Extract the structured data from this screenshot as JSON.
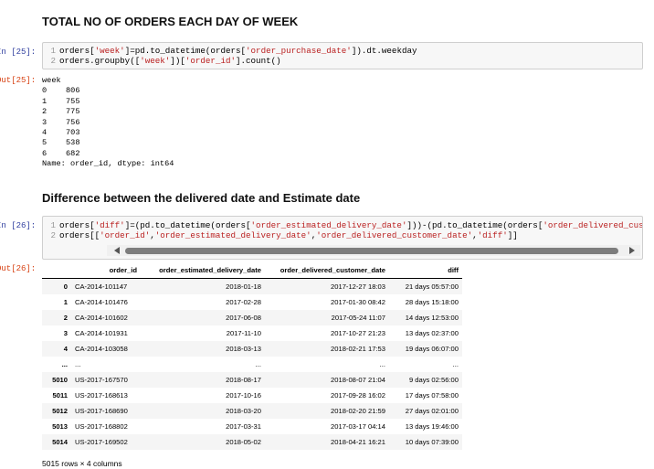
{
  "section1": {
    "heading": "TOTAL NO OF ORDERS EACH DAY OF WEEK",
    "in_prompt": "In [25]:",
    "out_prompt": "Out[25]:",
    "code": [
      {
        "num": "1",
        "parts": [
          "orders[",
          "'week'",
          "]=pd.to_datetime(orders[",
          "'order_purchase_date'",
          "]).dt.weekday"
        ]
      },
      {
        "num": "2",
        "parts": [
          "orders.groupby([",
          "'week'",
          "])[",
          "'order_id'",
          "].count()"
        ]
      }
    ],
    "output": {
      "header": "week",
      "rows": [
        {
          "idx": "0",
          "val": "806"
        },
        {
          "idx": "1",
          "val": "755"
        },
        {
          "idx": "2",
          "val": "775"
        },
        {
          "idx": "3",
          "val": "756"
        },
        {
          "idx": "4",
          "val": "703"
        },
        {
          "idx": "5",
          "val": "538"
        },
        {
          "idx": "6",
          "val": "682"
        }
      ],
      "footer": "Name: order_id, dtype: int64"
    }
  },
  "section2": {
    "heading": "Difference between the delivered date and Estimate date",
    "in_prompt": "In [26]:",
    "out_prompt": "Out[26]:",
    "code": [
      {
        "num": "1",
        "parts": [
          "orders[",
          "'diff'",
          "]=(pd.to_datetime(orders[",
          "'order_estimated_delivery_date'",
          "]))-(pd.to_datetime(orders[",
          "'order_delivered_customer_da",
          ""
        ]
      },
      {
        "num": "2",
        "parts": [
          "orders[[",
          "'order_id'",
          ",",
          "'order_estimated_delivery_date'",
          ",",
          "'order_delivered_customer_date'",
          ",",
          "'diff'",
          "]]"
        ]
      }
    ],
    "table": {
      "columns": [
        "",
        "order_id",
        "order_estimated_delivery_date",
        "order_delivered_customer_date",
        "diff"
      ],
      "rows": [
        [
          "0",
          "CA-2014-101147",
          "2018-01-18",
          "2017-12-27 18:03",
          "21 days 05:57:00"
        ],
        [
          "1",
          "CA-2014-101476",
          "2017-02-28",
          "2017-01-30 08:42",
          "28 days 15:18:00"
        ],
        [
          "2",
          "CA-2014-101602",
          "2017-06-08",
          "2017-05-24 11:07",
          "14 days 12:53:00"
        ],
        [
          "3",
          "CA-2014-101931",
          "2017-11-10",
          "2017-10-27 21:23",
          "13 days 02:37:00"
        ],
        [
          "4",
          "CA-2014-103058",
          "2018-03-13",
          "2018-02-21 17:53",
          "19 days 06:07:00"
        ],
        [
          "...",
          "...",
          "...",
          "...",
          "..."
        ],
        [
          "5010",
          "US-2017-167570",
          "2018-08-17",
          "2018-08-07 21:04",
          "9 days 02:56:00"
        ],
        [
          "5011",
          "US-2017-168613",
          "2017-10-16",
          "2017-09-28 16:02",
          "17 days 07:58:00"
        ],
        [
          "5012",
          "US-2017-168690",
          "2018-03-20",
          "2018-02-20 21:59",
          "27 days 02:01:00"
        ],
        [
          "5013",
          "US-2017-168802",
          "2017-03-31",
          "2017-03-17 04:14",
          "13 days 19:46:00"
        ],
        [
          "5014",
          "US-2017-169502",
          "2018-05-02",
          "2018-04-21 16:21",
          "10 days 07:39:00"
        ]
      ],
      "shape": "5015 rows × 4 columns"
    }
  },
  "colors": {
    "in_prompt": "#303f9f",
    "out_prompt": "#d84315",
    "string": "#ba2121",
    "scroll_thumb": "#7d7d7d"
  }
}
